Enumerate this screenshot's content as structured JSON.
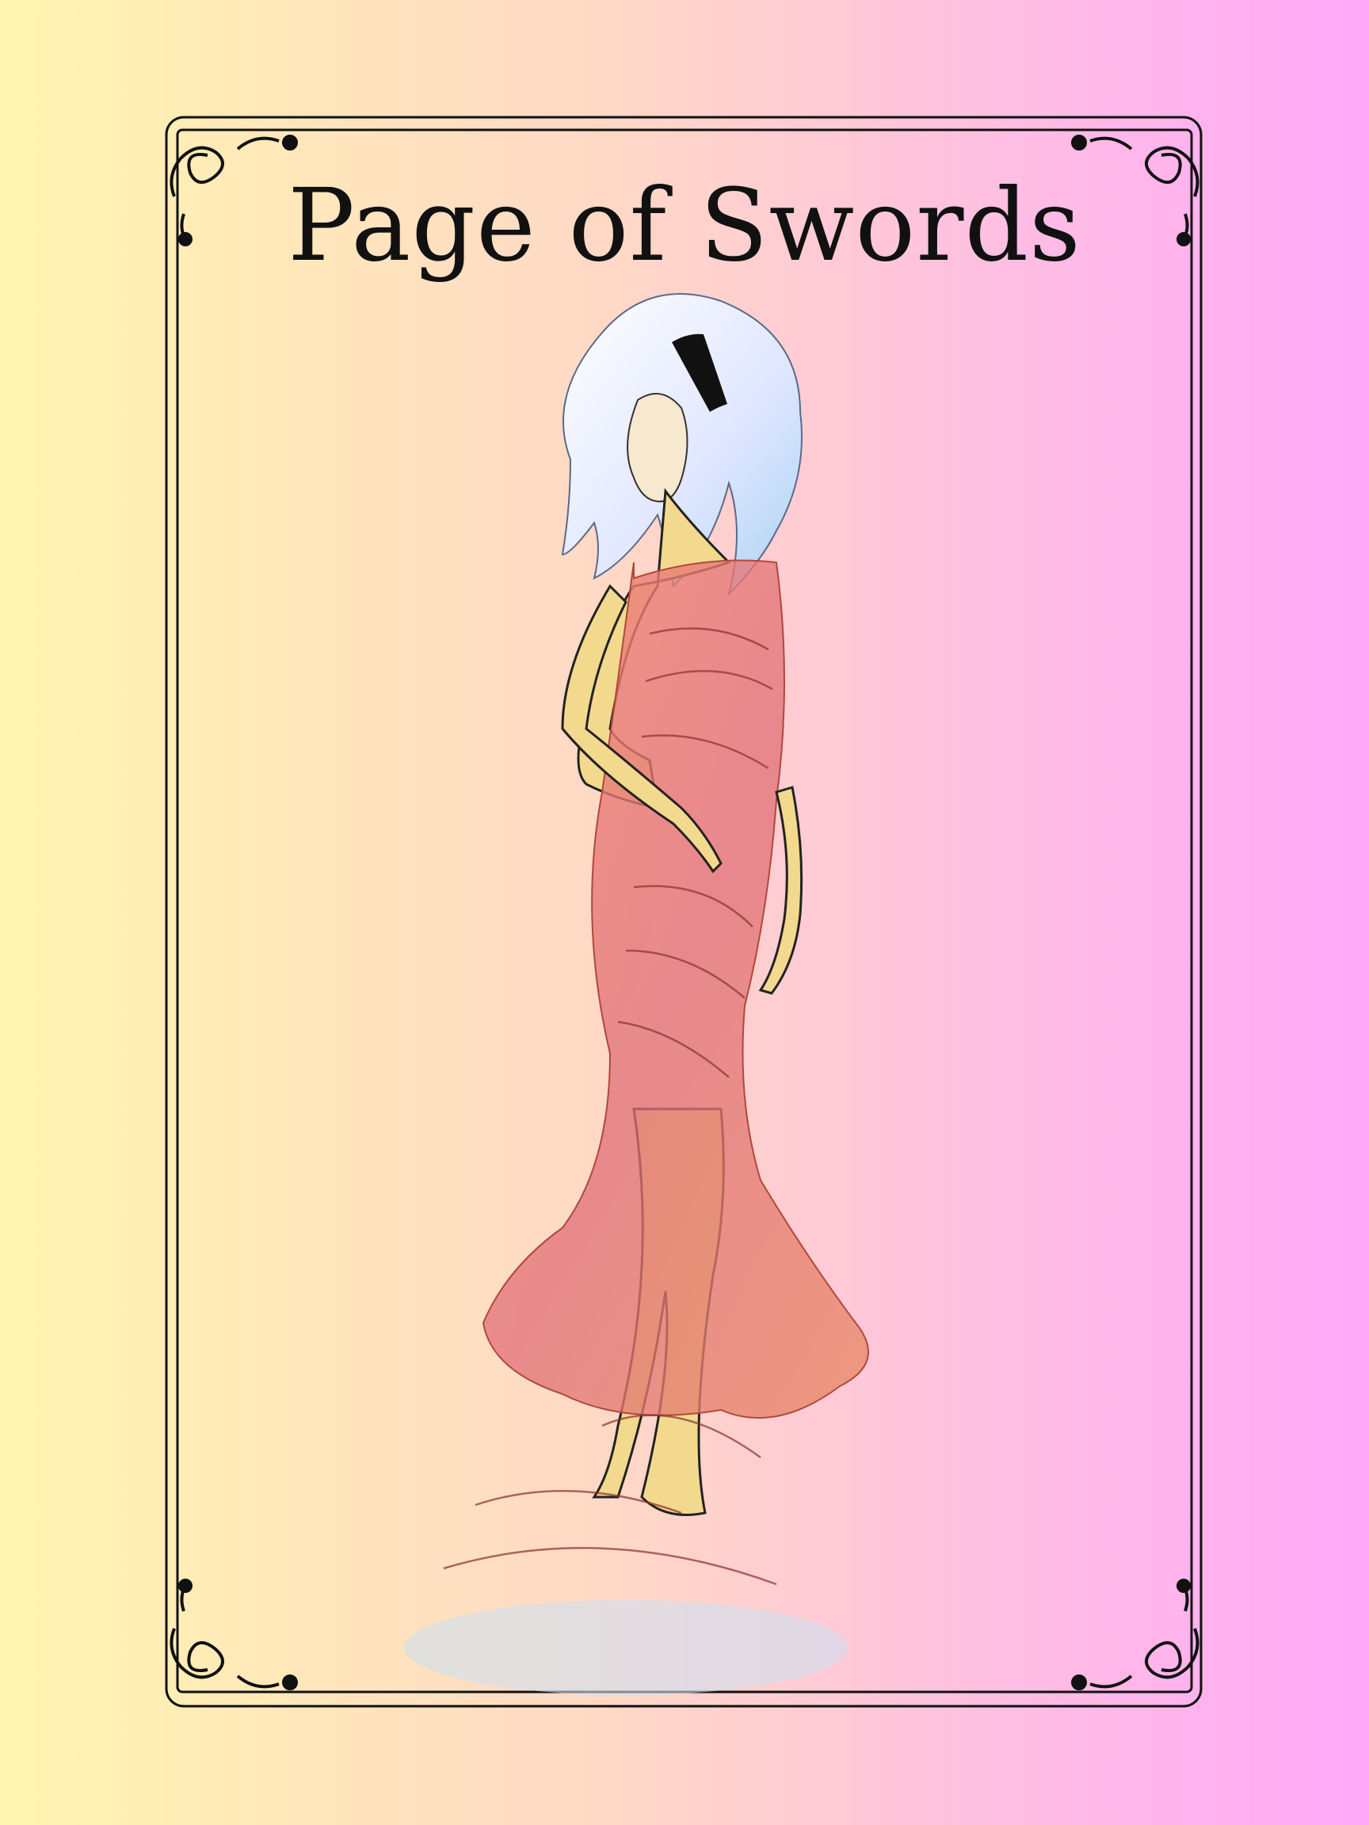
{
  "card": {
    "title": "Page of Swords"
  },
  "colors": {
    "background_left": "#fff5b0",
    "background_mid": "#ffd9c8",
    "background_right": "#ffa8f8",
    "frame": "#111111",
    "dress": "#e77f73",
    "hair": "#dfe8ff",
    "skin": "#f5dc91"
  },
  "illustration": {
    "subject": "standing-figure-with-white-hair-in-draped-dress"
  }
}
